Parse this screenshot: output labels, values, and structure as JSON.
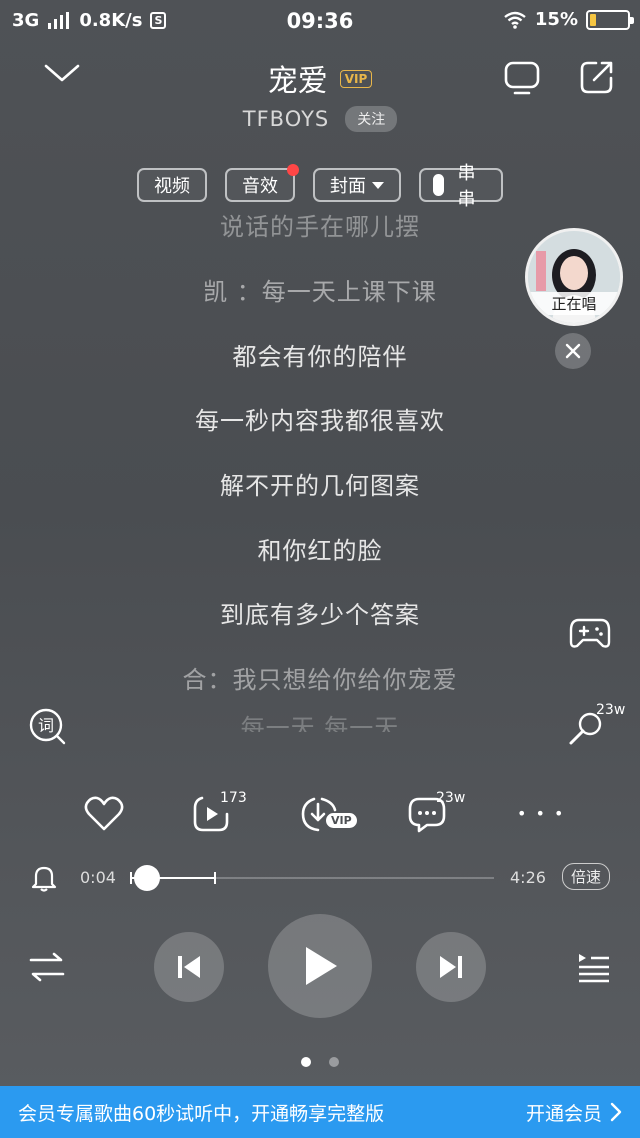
{
  "status_bar": {
    "network": "3G",
    "speed": "0.8K/s",
    "storage_badge": "S",
    "time": "09:36",
    "battery_percent": "15%",
    "battery_level": 0.15,
    "battery_color": "#f5c542"
  },
  "header": {
    "title": "宠爱",
    "vip_badge": "VIP",
    "artist": "TFBOYS",
    "follow_label": "关注",
    "icons": [
      "chevron-down-icon",
      "tv-cast-icon",
      "share-icon"
    ]
  },
  "chips": [
    {
      "label": "视频"
    },
    {
      "label": "音效",
      "has_dot": true
    },
    {
      "label": "封面"
    },
    {
      "label": "串串"
    }
  ],
  "lyrics": [
    "说话的手在哪儿摆",
    "凯 ：每一天上课下课",
    "都会有你的陪伴",
    "每一秒内容我都很喜欢",
    "解不开的几何图案",
    "和你红的脸",
    "到底有多少个答案",
    "合：我只想给你给你宠爱",
    "每一天 每一天"
  ],
  "floating": {
    "singer_label": "正在唱"
  },
  "side": {
    "mic_count": "23w"
  },
  "actions": {
    "share_count": "173",
    "download_badge": "VIP",
    "comment_count": "23w",
    "more_label": "• • •"
  },
  "playback": {
    "current_time": "0:04",
    "total_time": "4:26",
    "speed_label": "倍速",
    "progress_fraction": 0.016
  },
  "pager": {
    "count": 2,
    "active": 0
  },
  "banner": {
    "text": "会员专属歌曲60秒试听中，开通畅享完整版",
    "cta": "开通会员",
    "color": "#2b9af0"
  }
}
